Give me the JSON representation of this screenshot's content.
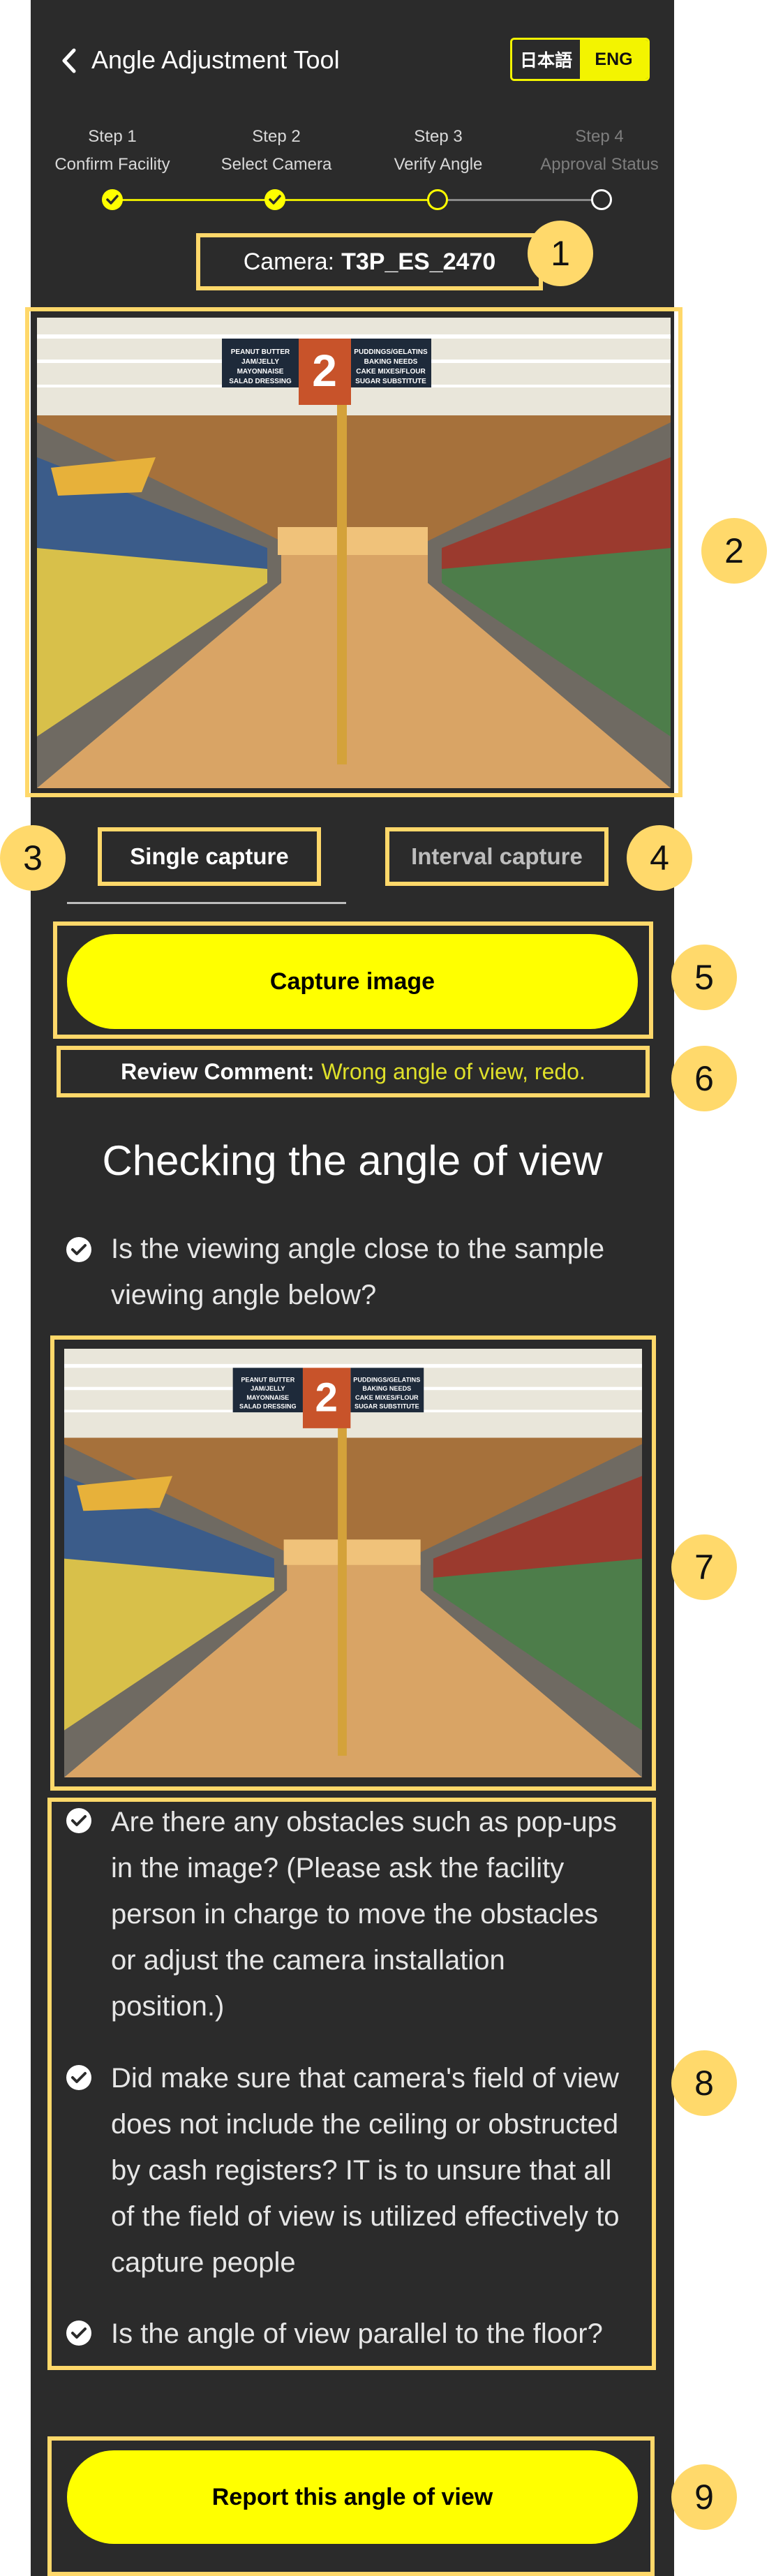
{
  "header": {
    "title": "Angle Adjustment Tool",
    "lang_ja": "日本語",
    "lang_en": "ENG"
  },
  "steps": [
    {
      "num": "Step 1",
      "label": "Confirm Facility"
    },
    {
      "num": "Step 2",
      "label": "Select Camera"
    },
    {
      "num": "Step 3",
      "label": "Verify Angle"
    },
    {
      "num": "Step 4",
      "label": "Approval Status"
    }
  ],
  "camera": {
    "label": "Camera:",
    "id": "T3P_ES_2470"
  },
  "photo_signs": {
    "aisle_number": "2",
    "left_sign": [
      "PEANUT BUTTER",
      "JAM/JELLY",
      "MAYONNAISE",
      "SALAD DRESSING"
    ],
    "right_sign": [
      "PUDDINGS/GELATINS",
      "BAKING NEEDS",
      "CAKE MIXES/FLOUR",
      "SUGAR SUBSTITUTE"
    ]
  },
  "tabs": {
    "single": "Single capture",
    "interval": "Interval capture"
  },
  "capture_button": "Capture image",
  "review": {
    "label": "Review Comment:",
    "value": "Wrong angle of view, redo."
  },
  "section_title": "Checking the angle of view",
  "questions": {
    "q1": [
      "Is the viewing angle close to the sample",
      "viewing angle below?"
    ],
    "q2": [
      "Are there any obstacles such as pop-ups",
      "in the image? (Please ask the facility",
      "person in charge to move the obstacles",
      "or adjust the camera installation",
      "position.)"
    ],
    "q3": [
      "Did make sure that camera's field of view",
      "does not include the ceiling or obstructed",
      "by cash registers? IT is to unsure that all",
      "of the field of view is utilized effectively to",
      "capture people"
    ],
    "q4": [
      "Is the angle of view parallel to the floor?"
    ]
  },
  "report_button": "Report this angle of view",
  "callouts": [
    "1",
    "2",
    "3",
    "4",
    "5",
    "6",
    "7",
    "8",
    "9"
  ],
  "colors": {
    "accent": "#ffff00",
    "panel": "#2b2b2b",
    "highlight": "#ffd86a",
    "callout": "#ffd96b",
    "review_value": "#dfe02a"
  }
}
